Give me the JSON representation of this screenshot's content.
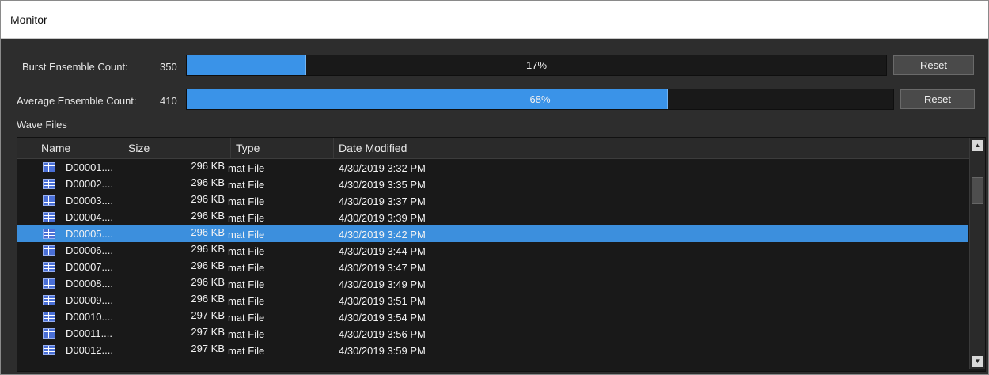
{
  "window": {
    "title": "Monitor"
  },
  "burst": {
    "label": "Burst Ensemble Count:",
    "count": "350",
    "progress": 0.17,
    "percent_text": "17%",
    "reset_label": "Reset"
  },
  "average": {
    "label": "Average Ensemble Count:",
    "count": "410",
    "progress": 0.68,
    "percent_text": "68%",
    "reset_label": "Reset"
  },
  "wave_files": {
    "label": "Wave Files",
    "columns": [
      "Name",
      "Size",
      "Type",
      "Date Modified"
    ],
    "rows": [
      {
        "name": "D00001....",
        "size": "296 KB",
        "type": "mat File",
        "date": "4/30/2019 3:32 PM"
      },
      {
        "name": "D00002....",
        "size": "296 KB",
        "type": "mat File",
        "date": "4/30/2019 3:35 PM"
      },
      {
        "name": "D00003....",
        "size": "296 KB",
        "type": "mat File",
        "date": "4/30/2019 3:37 PM"
      },
      {
        "name": "D00004....",
        "size": "296 KB",
        "type": "mat File",
        "date": "4/30/2019 3:39 PM"
      },
      {
        "name": "D00005....",
        "size": "296 KB",
        "type": "mat File",
        "date": "4/30/2019 3:42 PM",
        "selected": true
      },
      {
        "name": "D00006....",
        "size": "296 KB",
        "type": "mat File",
        "date": "4/30/2019 3:44 PM"
      },
      {
        "name": "D00007....",
        "size": "296 KB",
        "type": "mat File",
        "date": "4/30/2019 3:47 PM"
      },
      {
        "name": "D00008....",
        "size": "296 KB",
        "type": "mat File",
        "date": "4/30/2019 3:49 PM"
      },
      {
        "name": "D00009....",
        "size": "296 KB",
        "type": "mat File",
        "date": "4/30/2019 3:51 PM"
      },
      {
        "name": "D00010....",
        "size": "297 KB",
        "type": "mat File",
        "date": "4/30/2019 3:54 PM"
      },
      {
        "name": "D00011....",
        "size": "297 KB",
        "type": "mat File",
        "date": "4/30/2019 3:56 PM"
      },
      {
        "name": "D00012....",
        "size": "297 KB",
        "type": "mat File",
        "date": "4/30/2019 3:59 PM"
      }
    ],
    "row_icon": "mat-file-icon",
    "scroll_up_icon": "scroll-up-arrow-icon",
    "scroll_down_icon": "scroll-down-arrow-icon"
  },
  "colors": {
    "background": "#2d2d2d",
    "progress_fill": "#3a93e8",
    "selection": "#3c8fdd",
    "list_background": "#191919"
  }
}
